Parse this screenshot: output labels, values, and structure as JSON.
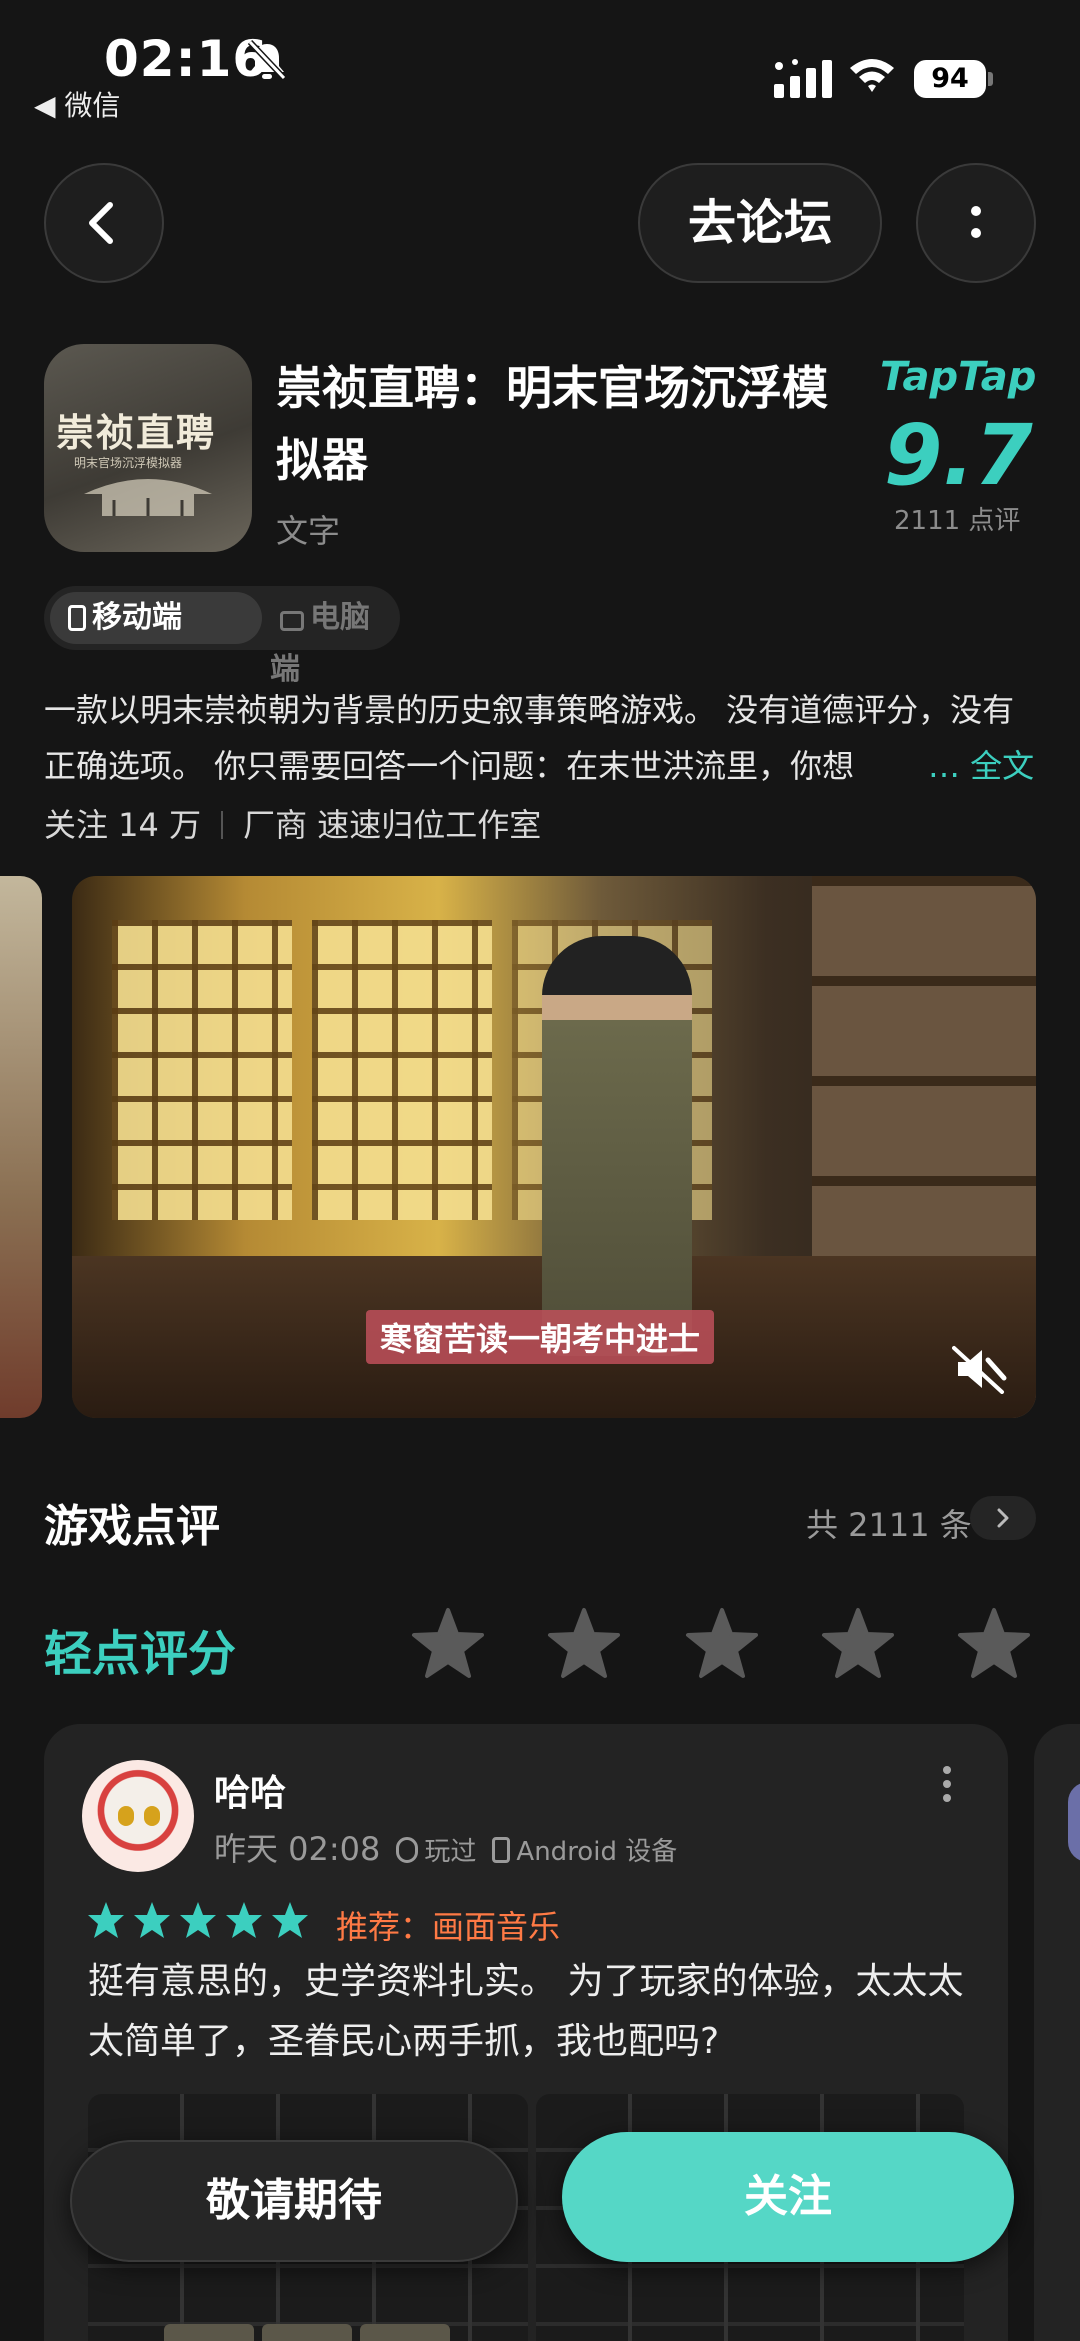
{
  "status_bar": {
    "time": "02:16",
    "back_app": "◀ 微信",
    "battery": "94"
  },
  "nav": {
    "forum_label": "去论坛"
  },
  "app": {
    "icon_title": "崇祯直聘",
    "icon_subtitle": "明末官场沉浮模拟器",
    "title": "崇祯直聘：明末官场沉浮模拟器",
    "genre": "文字",
    "rating_source": "TapTap",
    "rating": "9.7",
    "rating_count": "2111 点评"
  },
  "platforms": {
    "mobile": "移动端",
    "pc": "电脑端"
  },
  "description": {
    "text": "一款以明末崇祯朝为背景的历史叙事策略游戏。 没有道德评分，没有正确选项。 你只需要回答一个问题：在末世洪流里，你想",
    "more": "… 全文"
  },
  "meta": {
    "followers": "关注 14 万",
    "developer": "厂商 速速归位工作室"
  },
  "media": {
    "caption": "寒窗苦读一朝考中进士"
  },
  "reviews": {
    "section_title": "游戏点评",
    "total": "共 2111 条",
    "rate_label": "轻点评分",
    "colors": {
      "accent": "#3ccfbf",
      "star_empty": "#5a5a5a",
      "recommend": "#ff7a45"
    }
  },
  "review": {
    "user": "哈哈",
    "time": "昨天 02:08",
    "played": "玩过",
    "device": "Android 设备",
    "stars": 5,
    "recommend": "推荐：画面音乐",
    "text": "挺有意思的，史学资料扎实。 为了玩家的体验，太太太太简单了，圣眷民心两手抓，我也配吗?"
  },
  "actions": {
    "wait": "敬请期待",
    "follow": "关注"
  }
}
